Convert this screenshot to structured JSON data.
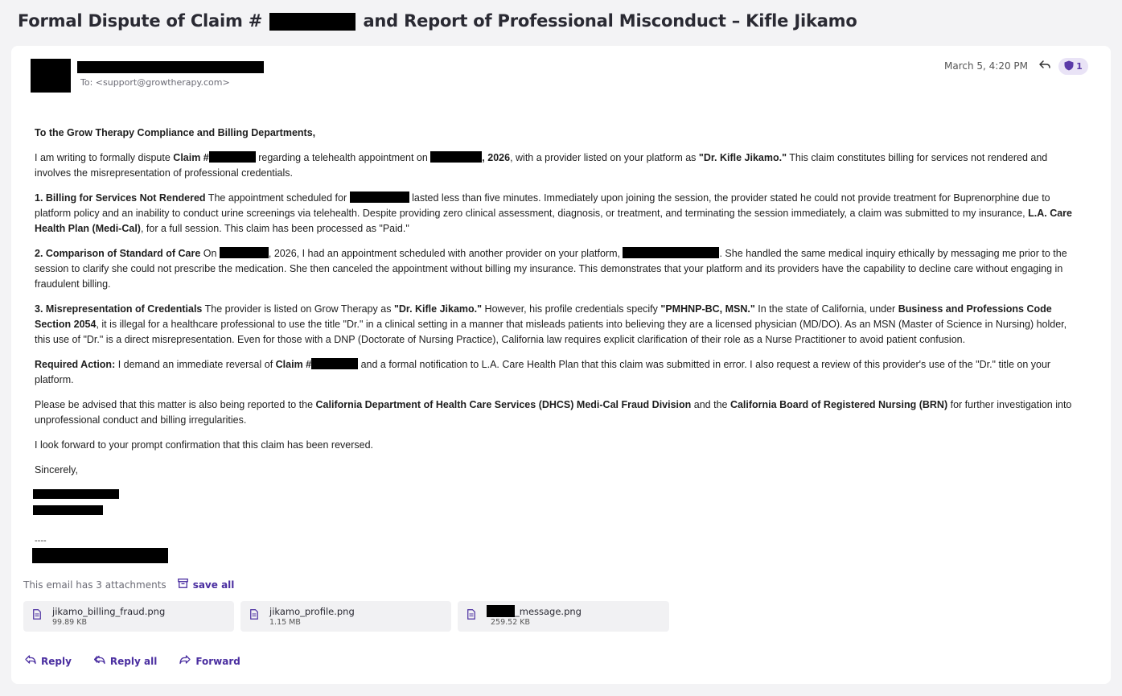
{
  "subject": {
    "prefix": "Formal Dispute of Claim #",
    "suffix": "and Report of Professional Misconduct – Kifle Jikamo"
  },
  "header": {
    "to": "To: <support@growtherapy.com>",
    "date": "March 5, 4:20 PM",
    "badge_count": "1"
  },
  "body": {
    "greeting": "To the Grow Therapy Compliance and Billing Departments,",
    "p1_a": "I am writing to formally dispute ",
    "p1_claim": "Claim #",
    "p1_b": " regarding a telehealth appointment on ",
    "p1_year": ", 2026",
    "p1_c": ", with a provider listed on your platform as ",
    "p1_provider": "\"Dr. Kifle Jikamo.\"",
    "p1_d": " This claim constitutes billing for services not rendered and involves the misrepresentation of professional credentials.",
    "p2_head": "1. Billing for Services Not Rendered",
    "p2_a": " The appointment scheduled for ",
    "p2_b": " lasted less than five minutes. Immediately upon joining the session, the provider stated he could not provide treatment for Buprenorphine due to platform policy and an inability to conduct urine screenings via telehealth. Despite providing zero clinical assessment, diagnosis, or treatment, and terminating the session immediately, a claim was submitted to my insurance, ",
    "p2_insurer": "L.A. Care Health Plan (Medi-Cal)",
    "p2_c": ", for a full session. This claim has been processed as \"Paid.\"",
    "p3_head": "2. Comparison of Standard of Care",
    "p3_a": " On ",
    "p3_b": ", 2026, I had an appointment scheduled with another provider on your platform, ",
    "p3_c": ". She handled the same medical inquiry ethically by messaging me prior to the session to clarify she could not prescribe the medication. She then canceled the appointment without billing my insurance. This demonstrates that your platform and its providers have the capability to decline care without engaging in fraudulent billing.",
    "p4_head": "3. Misrepresentation of Credentials",
    "p4_a": " The provider is listed on Grow Therapy as ",
    "p4_name": "\"Dr. Kifle Jikamo.\"",
    "p4_b": " However, his profile credentials specify ",
    "p4_cred": "\"PMHNP-BC, MSN.\"",
    "p4_c": " In the state of California, under ",
    "p4_code": "Business and Professions Code Section 2054",
    "p4_d": ", it is illegal for a healthcare professional to use the title \"Dr.\" in a clinical setting in a manner that misleads patients into believing they are a licensed physician (MD/DO). As an MSN (Master of Science in Nursing) holder, this use of \"Dr.\" is a direct misrepresentation. Even for those with a DNP (Doctorate of Nursing Practice), California law requires explicit clarification of their role as a Nurse Practitioner to avoid patient confusion.",
    "p5_head": "Required Action:",
    "p5_a": " I demand an immediate reversal of ",
    "p5_claim": "Claim #",
    "p5_b": " and a formal notification to L.A. Care Health Plan that this claim was submitted in error. I also request a review of this provider's use of the \"Dr.\" title on your platform.",
    "p6_a": "Please be advised that this matter is also being reported to the ",
    "p6_dhcs": "California Department of Health Care Services (DHCS) Medi-Cal Fraud Division",
    "p6_b": " and the ",
    "p6_brn": "California Board of Registered Nursing (BRN)",
    "p6_c": " for further investigation into unprofessional conduct and billing irregularities.",
    "p7": "I look forward to your prompt confirmation that this claim has been reversed.",
    "closing": "Sincerely,",
    "dashes": "----"
  },
  "attachments": {
    "summary": "This email has 3 attachments",
    "save_all": "save all",
    "items": [
      {
        "name": "jikamo_billing_fraud.png",
        "size": "99.89 KB"
      },
      {
        "name": "jikamo_profile.png",
        "size": "1.15 MB"
      },
      {
        "name": "_message.png",
        "size": "259.52 KB"
      }
    ]
  },
  "actions": {
    "reply": "Reply",
    "reply_all": "Reply all",
    "forward": "Forward"
  },
  "colors": {
    "accent": "#4a2ea0",
    "badge_bg": "#e9e3f6",
    "page_bg": "#f3f3f5"
  }
}
